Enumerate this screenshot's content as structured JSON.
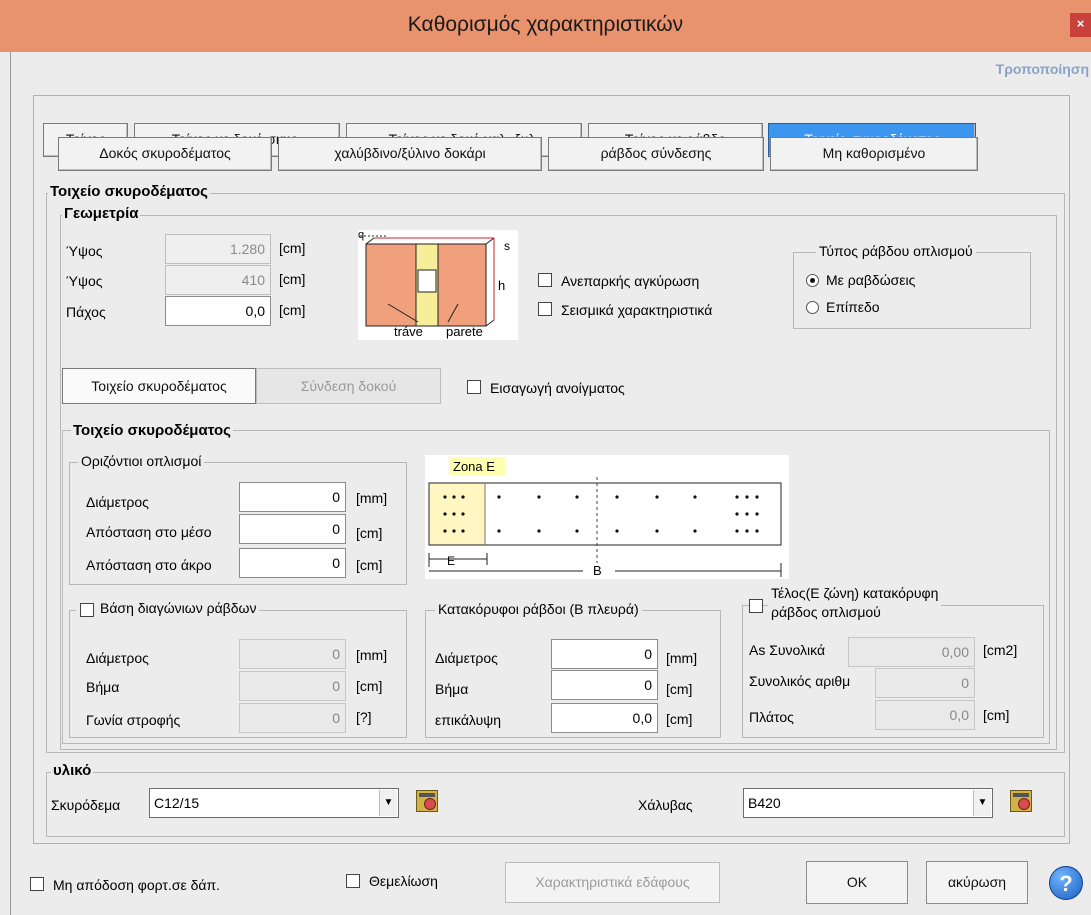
{
  "window": {
    "title": "Καθορισμός χαρακτηριστικών",
    "close": "×",
    "modify_link": "Τροποποίηση"
  },
  "tabs_row1": [
    {
      "label": "Τοίχος",
      "active": false
    },
    {
      "label": "Τοίχος με δοκό σκυρ.",
      "active": false
    },
    {
      "label": "Τοίχος με δοκό χαλ.-ξυλ.",
      "active": false
    },
    {
      "label": "Τοίχος με ράβδο",
      "active": false
    },
    {
      "label": "Τοιχείο σκυροδέματος",
      "active": true
    }
  ],
  "tabs_row2": [
    {
      "label": "Δοκός σκυροδέματος"
    },
    {
      "label": "χαλύβδινο/ξύλινο δοκάρι"
    },
    {
      "label": "ράβδος σύνδεσης"
    },
    {
      "label": "Μη καθορισμένο"
    }
  ],
  "section_title": "Τοιχείο σκυροδέματος",
  "geometry": {
    "title": "Γεωμετρία",
    "rows": [
      {
        "label": "Ύψος",
        "value": "1.280",
        "unit": "[cm]",
        "disabled": true
      },
      {
        "label": "Ύψος",
        "value": "410",
        "unit": "[cm]",
        "disabled": true
      },
      {
        "label": "Πάχος",
        "value": "0,0",
        "unit": "[cm]",
        "disabled": false
      }
    ],
    "diagram_labels": {
      "q": "q",
      "s": "s",
      "h": "h",
      "trave": "tráve",
      "parete": "parete"
    },
    "checks": [
      {
        "label": "Ανεπαρκής αγκύρωση",
        "checked": false
      },
      {
        "label": "Σεισμικά χαρακτηριστικά",
        "checked": false
      }
    ],
    "rebar_type": {
      "title": "Τύπος ράβδου οπλισμού",
      "options": [
        {
          "label": "Με ραβδώσεις",
          "selected": true
        },
        {
          "label": "Επίπεδο",
          "selected": false
        }
      ]
    }
  },
  "subtabs": [
    {
      "label": "Τοιχείο σκυροδέματος",
      "active": true
    },
    {
      "label": "Σύνδεση δοκού",
      "active": false
    }
  ],
  "opening_check": {
    "label": "Εισαγωγή ανοίγματος",
    "checked": false
  },
  "wall": {
    "title": "Τοιχείο σκυροδέματος",
    "horizontal": {
      "title": "Οριζόντιοι οπλισμοί",
      "rows": [
        {
          "label": "Διάμετρος",
          "value": "0",
          "unit": "[mm]"
        },
        {
          "label": "Απόσταση στο μέσο",
          "value": "0",
          "unit": "[cm]"
        },
        {
          "label": "Απόσταση στο άκρο",
          "value": "0",
          "unit": "[cm]"
        }
      ]
    },
    "zone_diagram": {
      "zone_label": "Zona E",
      "e_label": "E",
      "b_label": "B"
    },
    "diagonal": {
      "title": "Βάση διαγώνιων ράβδων",
      "checked": false,
      "rows": [
        {
          "label": "Διάμετρος",
          "value": "0",
          "unit": "[mm]"
        },
        {
          "label": "Βήμα",
          "value": "0",
          "unit": "[cm]"
        },
        {
          "label": "Γωνία στροφής",
          "value": "0",
          "unit": "[?]"
        }
      ]
    },
    "vertical": {
      "title": "Κατακόρυφοι ράβδοι (Β πλευρά)",
      "rows": [
        {
          "label": "Διάμετρος",
          "value": "0",
          "unit": "[mm]"
        },
        {
          "label": "Βήμα",
          "value": "0",
          "unit": "[cm]"
        },
        {
          "label": "επικάλυψη",
          "value": "0,0",
          "unit": "[cm]"
        }
      ]
    },
    "end_zone": {
      "title_line1": "Τέλος(Ε ζώνη) κατακόρυφη",
      "title_line2": "ράβδος οπλισμού",
      "checked": false,
      "rows": [
        {
          "label": "As Συνολικά",
          "value": "0,00",
          "unit": "[cm2]"
        },
        {
          "label": "Συνολικός αριθμ",
          "value": "0",
          "unit": ""
        },
        {
          "label": "Πλάτος",
          "value": "0,0",
          "unit": "[cm]"
        }
      ]
    }
  },
  "material": {
    "title": "υλικό",
    "concrete_label": "Σκυρόδεμα",
    "concrete_value": "C12/15",
    "steel_label": "Χάλυβας",
    "steel_value": "B420"
  },
  "footer": {
    "no_load_check": {
      "label": "Μη απόδοση φορτ.σε δάπ.",
      "checked": false
    },
    "foundation_check": {
      "label": "Θεμελίωση",
      "checked": false
    },
    "soil_button": "Χαρακτηριστικά εδάφους",
    "ok_button": "OK",
    "cancel_button": "ακύρωση",
    "help": "?"
  }
}
